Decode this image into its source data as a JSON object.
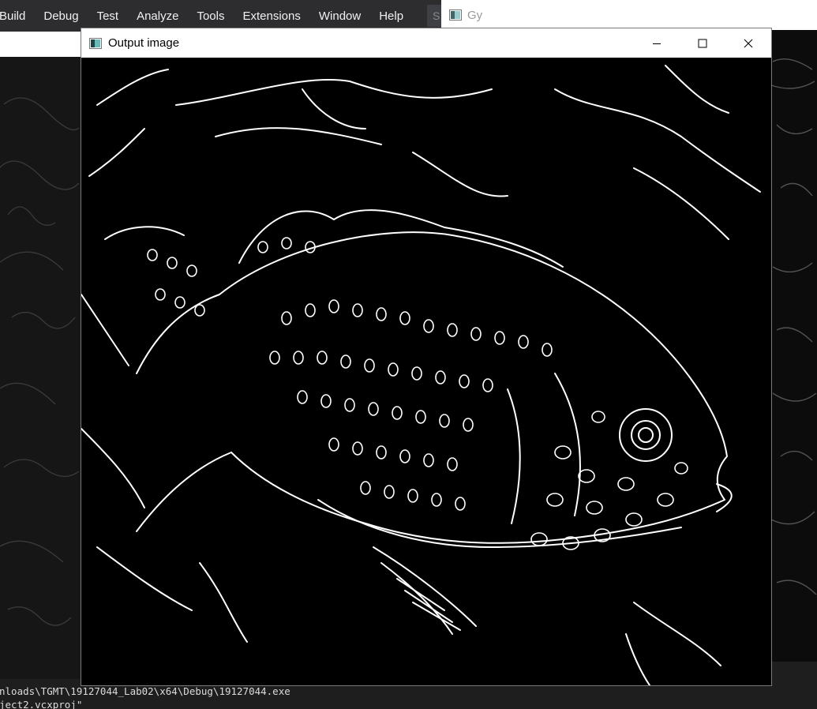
{
  "menubar": {
    "items": [
      "Build",
      "Debug",
      "Test",
      "Analyze",
      "Tools",
      "Extensions",
      "Window",
      "Help"
    ],
    "search_stub": "S"
  },
  "gy_window": {
    "title": "Gy"
  },
  "output_window": {
    "title": "Output image",
    "controls": {
      "minimize": "minimize-icon",
      "maximize": "maximize-icon",
      "close": "close-icon"
    }
  },
  "console": {
    "lines": [
      "nloads\\TGMT\\19127044_Lab02\\x64\\Debug\\19127044.exe",
      "ject2.vcxproj\""
    ]
  },
  "colors": {
    "menubar_bg": "#2d2d30",
    "titlebar_bg": "#ffffff",
    "edge_line": "#ffffff",
    "image_bg": "#000000"
  }
}
